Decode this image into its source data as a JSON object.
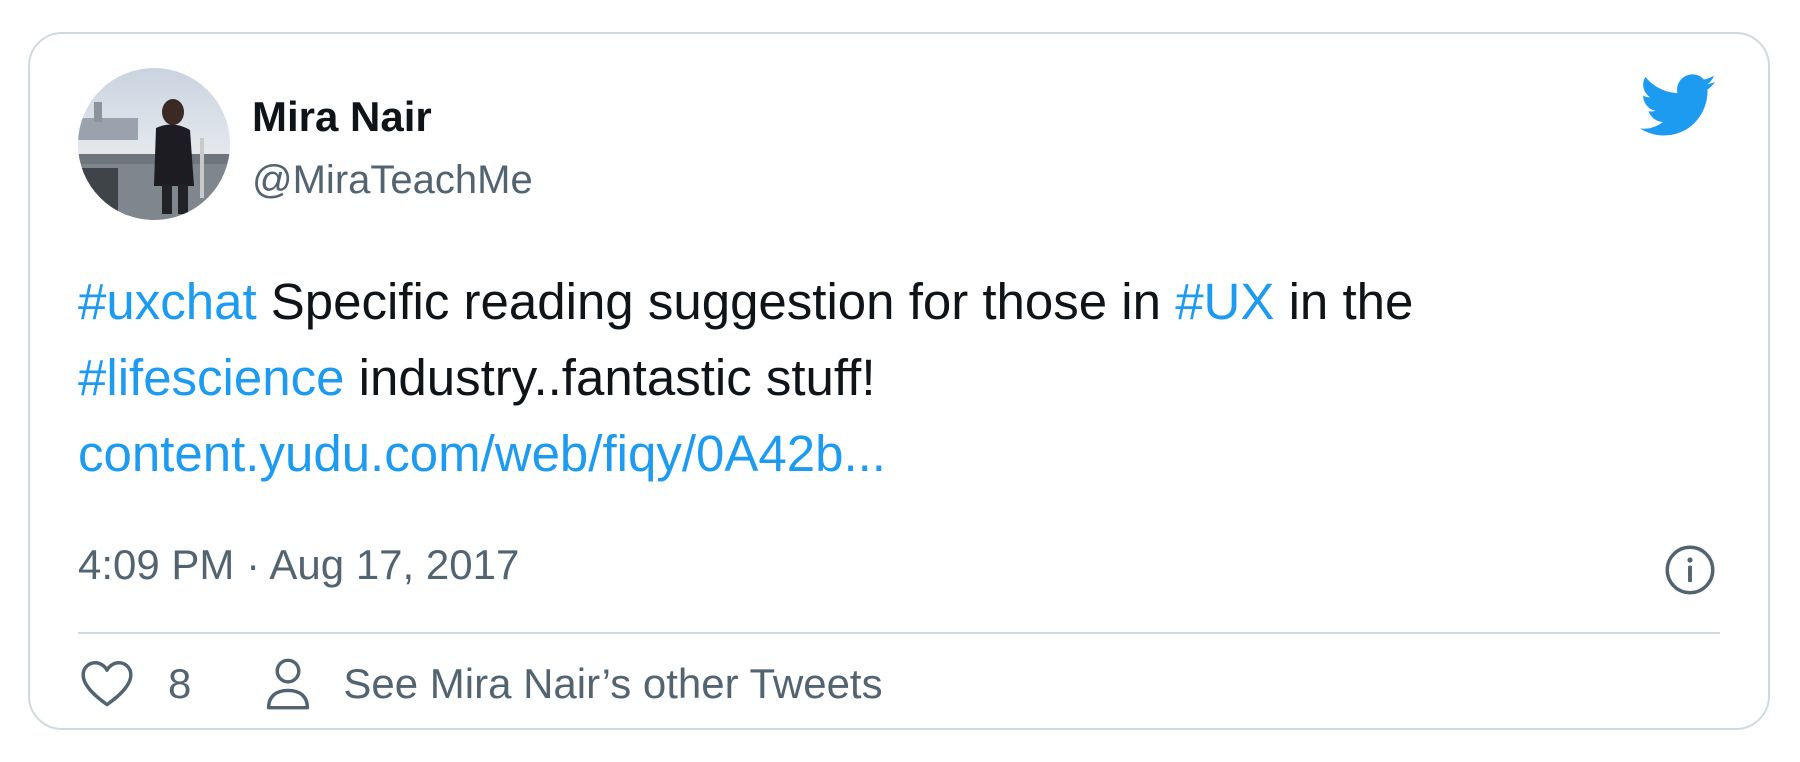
{
  "author": {
    "name": "Mira Nair",
    "handle": "@MiraTeachMe"
  },
  "tweet": {
    "hashtag_1": "#uxchat",
    "text_1": " Specific reading suggestion for those in ",
    "hashtag_2": "#UX",
    "text_2": " in the ",
    "hashtag_3": "#lifescience",
    "text_3": " industry..fantastic stuff!",
    "link": "content.yudu.com/web/fiqy/0A42b..."
  },
  "timestamp": "4:09 PM · Aug 17, 2017",
  "actions": {
    "like_count": "8",
    "other_tweets_label": "See Mira Nair’s other Tweets"
  },
  "colors": {
    "link_blue": "#1d9bf0",
    "text": "#0f1419",
    "secondary_text": "#536471",
    "border": "#cfd9de"
  },
  "icons": {
    "brand": "twitter-bird-icon",
    "info": "info-icon",
    "like": "heart-icon",
    "profile": "person-icon"
  }
}
